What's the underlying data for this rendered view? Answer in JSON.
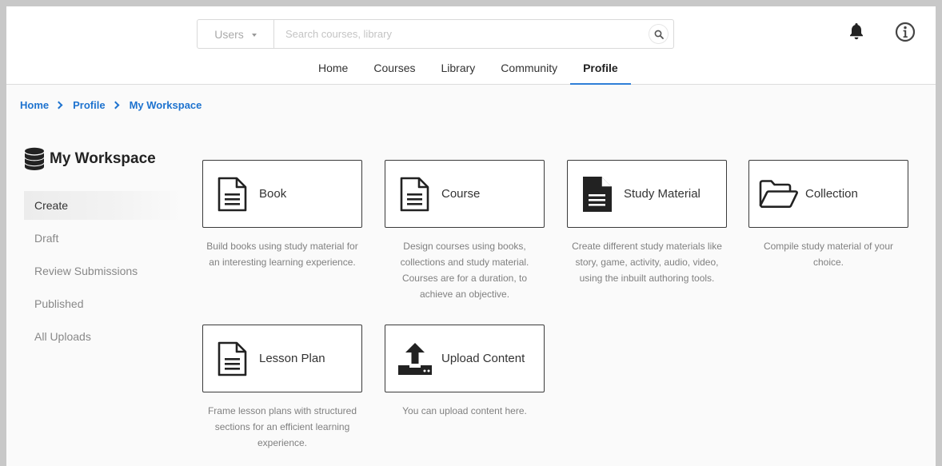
{
  "header": {
    "search_filter": "Users",
    "search_placeholder": "Search courses, library"
  },
  "nav": {
    "home": "Home",
    "courses": "Courses",
    "library": "Library",
    "community": "Community",
    "profile": "Profile"
  },
  "breadcrumb": {
    "home": "Home",
    "profile": "Profile",
    "workspace": "My Workspace"
  },
  "workspace": {
    "title": "My Workspace",
    "menu": [
      "Create",
      "Draft",
      "Review Submissions",
      "Published",
      "All Uploads"
    ],
    "active_menu": "Create"
  },
  "cards": [
    {
      "label": "Book",
      "icon": "file-text-outline-icon",
      "desc": "Build books using study material for an interesting learning experience."
    },
    {
      "label": "Course",
      "icon": "file-text-outline-icon",
      "desc": "Design courses using books, collections and study material. Courses are for a duration, to achieve an objective."
    },
    {
      "label": "Study Material",
      "icon": "file-text-solid-icon",
      "desc": "Create different study materials like story, game, activity, audio, video, using the inbuilt authoring tools."
    },
    {
      "label": "Collection",
      "icon": "folder-open-icon",
      "desc": "Compile study material of your choice."
    },
    {
      "label": "Lesson Plan",
      "icon": "file-text-outline-icon",
      "desc": "Frame lesson plans with structured sections for an efficient learning experience."
    },
    {
      "label": "Upload Content",
      "icon": "upload-icon",
      "desc": "You can upload content here."
    }
  ],
  "colors": {
    "link": "#1e73cf",
    "active_tab_underline": "#2f7fd8",
    "card_border": "#3a3a3a"
  }
}
